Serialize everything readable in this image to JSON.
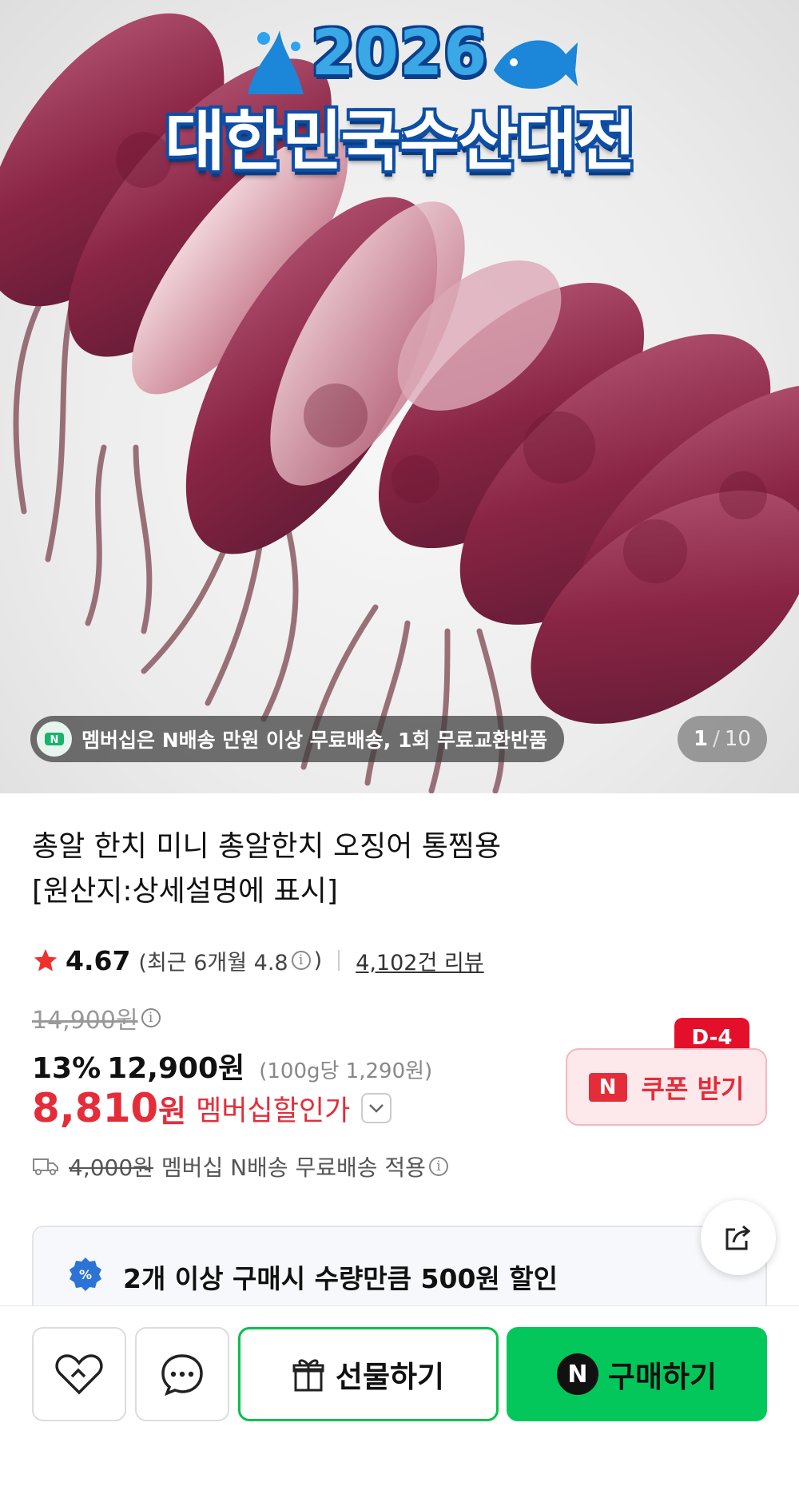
{
  "hero": {
    "event_year": "2026",
    "event_title": "대한민국수산대전",
    "membership_notice": "멤버십은 N배송 만원 이상 무료배송, 1회 무료교환반품",
    "image_index": "1",
    "image_sep": "/",
    "image_total": "10"
  },
  "product": {
    "title_line1": "총알 한치 미니 총알한치 오징어 통찜용",
    "title_line2": "[원산지:상세설명에 표시]",
    "rating": "4.67",
    "recent_rating": "(최근 6개월 4.8",
    "recent_close": ")",
    "review_count": "4,102건 리뷰",
    "original_price": "14,900원",
    "discount_rate": "13%",
    "sale_price": "12,900원",
    "unit_price": "(100g당 1,290원)",
    "member_price": "8,810",
    "member_won": "원",
    "member_label": "멤버십할인가",
    "shipping_old": "4,000원",
    "shipping_text": "멤버십 N배송 무료배송 적용"
  },
  "coupon": {
    "dday": "D-4",
    "n_mark": "N",
    "label": "쿠폰 받기"
  },
  "discount_card": {
    "text": "2개 이상 구매시 수량만큼 500원 할인"
  },
  "bottom_bar": {
    "gift_label": "선물하기",
    "buy_n": "N",
    "buy_label": "구매하기"
  },
  "colors": {
    "accent_red": "#e52d3a",
    "naver_green": "#03c75a",
    "dday_red": "#e4102b"
  },
  "icons": [
    "star-icon",
    "info-icon",
    "chevron-down-icon",
    "truck-icon",
    "share-icon",
    "percent-badge-icon",
    "heart-icon",
    "chat-icon",
    "gift-icon"
  ]
}
